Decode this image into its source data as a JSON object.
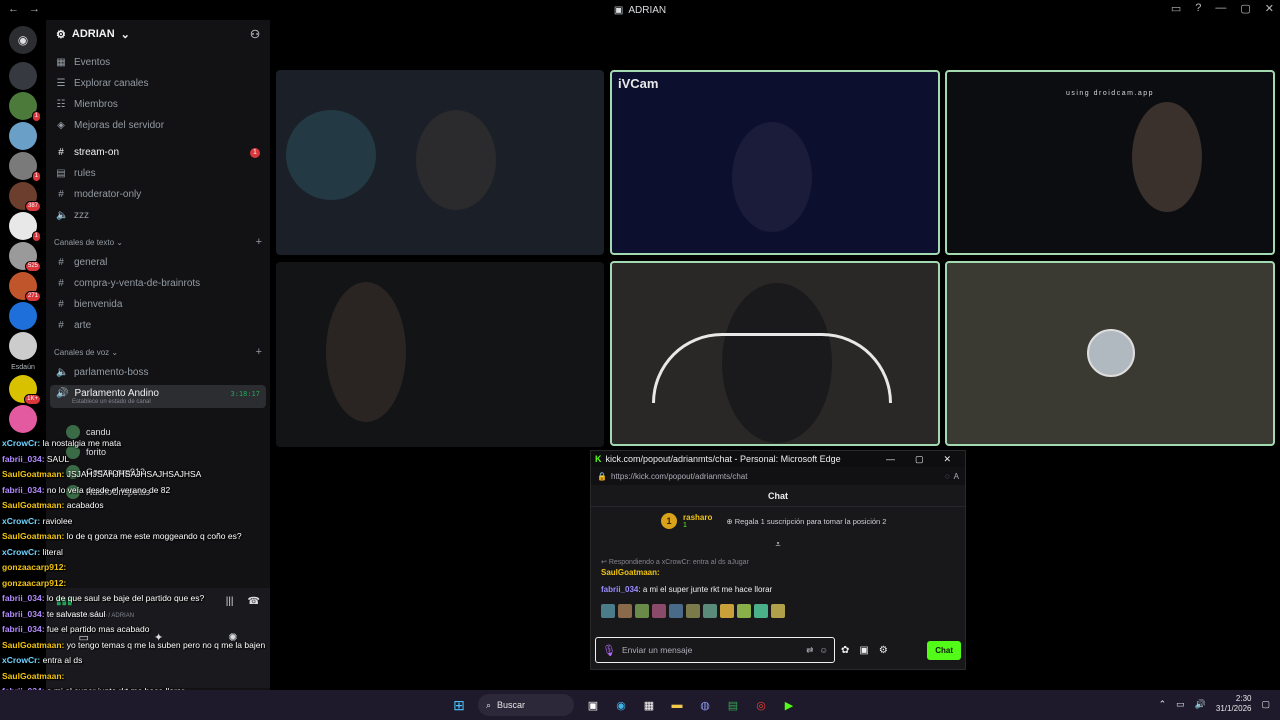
{
  "window": {
    "title": "ADRIAN",
    "back_icon": "arrow-left",
    "forward_icon": "arrow-right"
  },
  "server_rail": {
    "items": [
      {
        "name": "discord-home",
        "color": "#2b2d31",
        "badge": ""
      },
      {
        "name": "server-1",
        "color": "#36393f",
        "badge": ""
      },
      {
        "name": "server-2",
        "color": "#4c7a3a",
        "badge": "1"
      },
      {
        "name": "server-3",
        "color": "#6aa0c8",
        "badge": ""
      },
      {
        "name": "server-4",
        "color": "#7a7a7a",
        "badge": "1"
      },
      {
        "name": "server-5",
        "color": "#6b3e2e",
        "badge": "387"
      },
      {
        "name": "server-6",
        "color": "#e8e8e8",
        "badge": "1"
      },
      {
        "name": "server-7",
        "color": "#9a9a9a",
        "badge": "525"
      },
      {
        "name": "server-8",
        "color": "#c0552b",
        "badge": "271"
      },
      {
        "name": "server-9",
        "color": "#1e6fd9",
        "badge": ""
      },
      {
        "name": "server-10",
        "color": "#ccc",
        "badge": ""
      },
      {
        "name": "server-11",
        "color": "#d8c200",
        "badge": "1K+"
      },
      {
        "name": "server-12",
        "color": "#e45aa0",
        "badge": ""
      }
    ],
    "folder_label": "Esdaún"
  },
  "guild": {
    "name": "ADRIAN",
    "nav": [
      {
        "label": "Eventos",
        "icon": "calendar-icon",
        "glyph": "▦"
      },
      {
        "label": "Explorar canales",
        "icon": "list-icon",
        "glyph": "☰"
      },
      {
        "label": "Miembros",
        "icon": "members-icon",
        "glyph": "☷"
      },
      {
        "label": "Mejoras del servidor",
        "icon": "boost-icon",
        "glyph": "◈"
      }
    ],
    "channels_top": [
      {
        "name": "stream-on",
        "glyph": "#",
        "unread": true,
        "ping": "1"
      },
      {
        "name": "rules",
        "glyph": "▤",
        "unread": false,
        "ping": ""
      },
      {
        "name": "moderator-only",
        "glyph": "#",
        "unread": false,
        "ping": ""
      },
      {
        "name": "zzz",
        "glyph": "🔈",
        "unread": false,
        "ping": ""
      }
    ],
    "text_category": "Canales de texto",
    "text_channels": [
      "general",
      "compra-y-venta-de-brainrots",
      "bienvenida",
      "arte"
    ],
    "voice_category": "Canales de voz",
    "voice_channels": [
      "parlamento-boss"
    ],
    "active_voice": {
      "name": "Parlamento Andino",
      "timer": "3:18:17",
      "status": "Establece un estado de canal"
    },
    "voice_users": [
      "candu",
      "forito",
      "Gonzacarp912",
      "NachoCrispetas"
    ],
    "connection": "Parlamento Andino / ADRIAN"
  },
  "overlay_chat": [
    {
      "user": "xCrowCr",
      "text": "la nostalgia me mata",
      "color": "#6fd3ff"
    },
    {
      "user": "fabrii_034",
      "text": "SAUL",
      "color": "#b38cff"
    },
    {
      "user": "SaulGoatmaan",
      "text": "JSJAHJSAHJHSAJHSAJHSAJHSA",
      "color": "#f1c40f"
    },
    {
      "user": "fabrii_034",
      "text": "no lo veía desde el verano de 82",
      "color": "#b38cff"
    },
    {
      "user": "SaulGoatmaan",
      "text": "acabados",
      "color": "#f1c40f"
    },
    {
      "user": "xCrowCr",
      "text": "raviolee",
      "color": "#6fd3ff"
    },
    {
      "user": "SaulGoatmaan",
      "text": "lo de q gonza me este moggeando q coño es?",
      "color": "#f1c40f"
    },
    {
      "user": "xCrowCr",
      "text": "literal",
      "color": "#6fd3ff"
    },
    {
      "user": "gonzaacarp912",
      "text": "",
      "color": "#f1c40f"
    },
    {
      "user": "gonzaacarp912",
      "text": "",
      "color": "#f1c40f"
    },
    {
      "user": "fabrii_034",
      "text": "lo de que saul se baje del partido que es?",
      "color": "#b38cff"
    },
    {
      "user": "fabrii_034",
      "text": "te salvaste sául",
      "color": "#b38cff"
    },
    {
      "user": "fabrii_034",
      "text": "fue el partido mas acabado",
      "color": "#b38cff"
    },
    {
      "user": "SaulGoatmaan",
      "text": "yo tengo temas q me la suben pero no q me la bajen",
      "color": "#f1c40f"
    },
    {
      "user": "xCrowCr",
      "text": "entra al ds",
      "color": "#6fd3ff"
    },
    {
      "user": "SaulGoatmaan",
      "text": "",
      "color": "#f1c40f"
    },
    {
      "user": "fabrii_034",
      "text": "a mi el super junte rkt me hace llorar",
      "color": "#b38cff"
    }
  ],
  "video_tiles": [
    {
      "id": "tile-1",
      "label": "",
      "watermark": "",
      "bg": "#1a1f28",
      "speaking": false
    },
    {
      "id": "tile-2",
      "label": "iVCam",
      "watermark": "",
      "bg": "#0d0f2e",
      "speaking": true
    },
    {
      "id": "tile-3",
      "label": "",
      "watermark": "using droidcam.app",
      "bg": "#0b0d10",
      "speaking": true
    },
    {
      "id": "tile-4",
      "label": "",
      "watermark": "",
      "bg": "#121416",
      "speaking": false
    },
    {
      "id": "tile-5",
      "label": "",
      "watermark": "",
      "bg": "#2a2826",
      "speaking": true
    },
    {
      "id": "tile-6",
      "label": "",
      "watermark": "",
      "bg": "#3a3a32",
      "speaking": true
    }
  ],
  "popout": {
    "title": "kick.com/popout/adrianmts/chat - Personal: Microsoft Edge",
    "url": "https://kick.com/popout/adrianmts/chat",
    "header": "Chat",
    "leader_rank": "1",
    "leader_name": "rasharo",
    "leader_count": "1",
    "gift_text": "Regala 1 suscripción para tomar la posición 2",
    "reply_to": "Respondiendo a xCrowCr: entra al ds aJugar",
    "reply_user": "SaulGoatmaan:",
    "message_user": "fabrii_034",
    "message_text": "a mi el super junte rkt me hace llorar",
    "input_placeholder": "Enviar un mensaje",
    "send_label": "Chat",
    "emote_colors": [
      "#4a7c8a",
      "#8a6a4a",
      "#6a8a4a",
      "#8a4a6a",
      "#4a6a8a",
      "#7a7a4a",
      "#5a8a7a",
      "#caa03a",
      "#8ab04a",
      "#4ab08a",
      "#b0a04a"
    ]
  },
  "taskbar": {
    "search_label": "Buscar",
    "time": "2:30",
    "date": "31/1/2026"
  }
}
